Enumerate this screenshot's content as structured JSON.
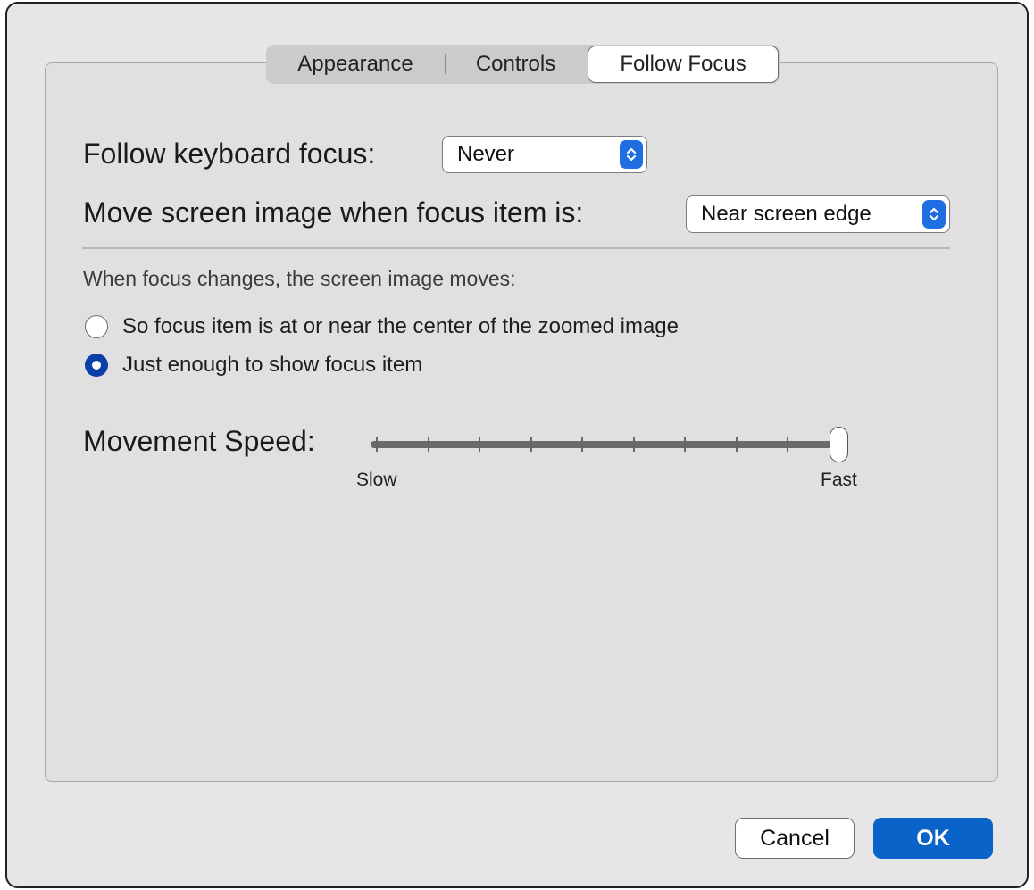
{
  "tabs": {
    "appearance": "Appearance",
    "controls": "Controls",
    "follow_focus": "Follow Focus",
    "selected": "Follow Focus"
  },
  "follow_keyboard": {
    "label": "Follow keyboard focus:",
    "value": "Never"
  },
  "move_image": {
    "label": "Move screen image when focus item is:",
    "value": "Near screen edge"
  },
  "focus_changes": {
    "caption": "When focus changes, the screen image moves:",
    "options": [
      {
        "label": "So focus item is at or near the center of the zoomed image",
        "selected": false
      },
      {
        "label": "Just enough to show focus item",
        "selected": true
      }
    ]
  },
  "movement_speed": {
    "label": "Movement Speed:",
    "min_label": "Slow",
    "max_label": "Fast",
    "value": 1.0,
    "tick_count": 10
  },
  "buttons": {
    "cancel": "Cancel",
    "ok": "OK"
  },
  "colors": {
    "accent": "#1f6fe3",
    "ok_button": "#0a63c9",
    "radio_selected": "#0b3fa8",
    "window_bg": "#e6e6e6"
  },
  "icons": {
    "popup_stepper": "chevron-up-down-icon"
  }
}
